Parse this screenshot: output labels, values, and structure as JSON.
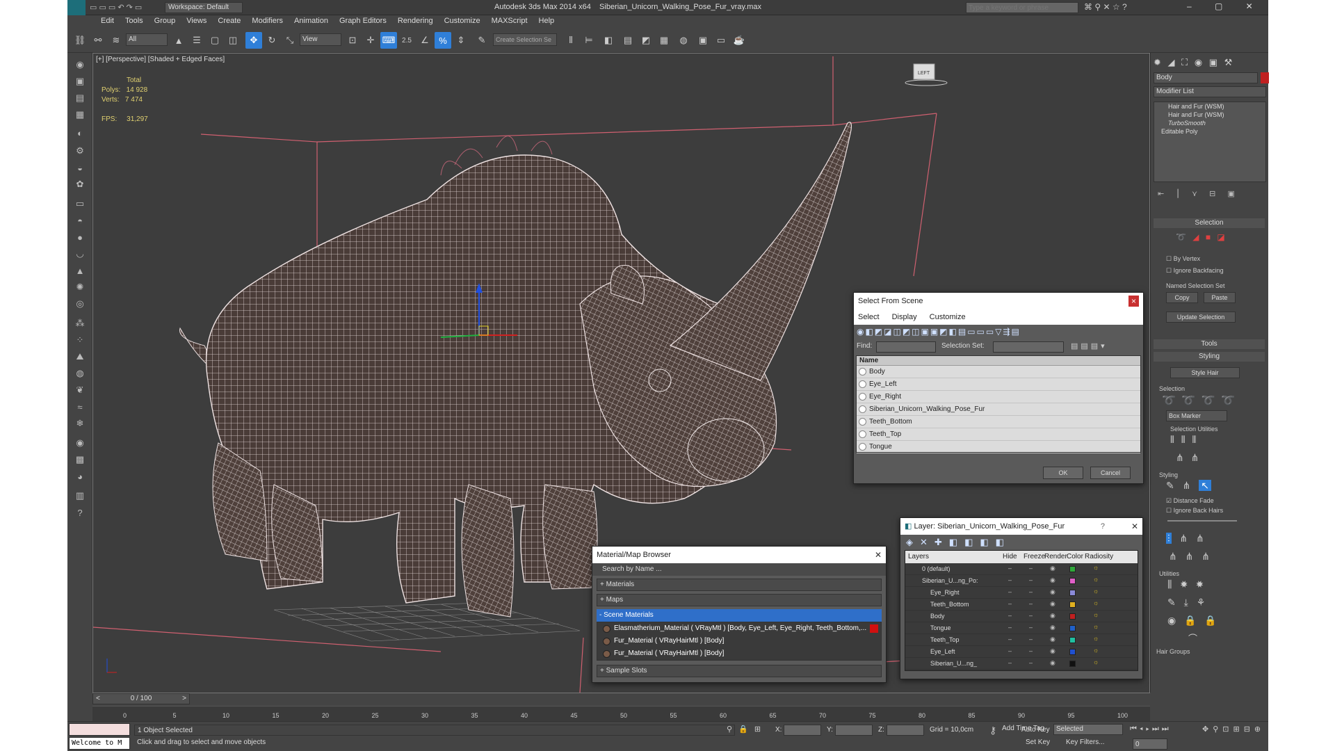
{
  "title": {
    "workspace": "Workspace: Default",
    "app": "Autodesk 3ds Max  2014 x64",
    "file": "Siberian_Unicorn_Walking_Pose_Fur_vray.max",
    "search_placeholder": "Type a keyword or phrase"
  },
  "menu": [
    "Edit",
    "Tools",
    "Group",
    "Views",
    "Create",
    "Modifiers",
    "Animation",
    "Graph Editors",
    "Rendering",
    "Customize",
    "MAXScript",
    "Help"
  ],
  "toolbar": {
    "filter": "All",
    "ref_coord": "View",
    "snap_val": "2.5",
    "selset": "Create Selection Se"
  },
  "viewport": {
    "label": "[+] [Perspective] [Shaded + Edged Faces]",
    "stats_total": "Total",
    "polys_label": "Polys:",
    "polys": "14 928",
    "verts_label": "Verts:",
    "verts": "7 474",
    "fps_label": "FPS:",
    "fps": "31,297"
  },
  "cmd": {
    "object_name": "Body",
    "modifier_list": "Modifier List",
    "stack": [
      "Hair and Fur (WSM)",
      "Hair and Fur (WSM)",
      "TurboSmooth",
      "Editable Poly"
    ],
    "selection_hdr": "Selection",
    "by_vertex": "By Vertex",
    "ignore_backfacing": "Ignore Backfacing",
    "named_sel": "Named Selection Set",
    "copy": "Copy",
    "paste": "Paste",
    "update_sel": "Update Selection",
    "tools_hdr": "Tools",
    "styling_hdr": "Styling",
    "style_hair": "Style Hair",
    "selection_sub": "Selection",
    "box_marker": "Box Marker",
    "sel_utils": "Selection Utilities",
    "styling_sub": "Styling",
    "distance_fade": "Distance Fade",
    "ignore_back_hairs": "Ignore Back Hairs",
    "utilities": "Utilities",
    "hair_groups": "Hair Groups"
  },
  "select_from_scene": {
    "title": "Select From Scene",
    "menus": [
      "Select",
      "Display",
      "Customize"
    ],
    "find": "Find:",
    "selection_set": "Selection Set:",
    "col_name": "Name",
    "items": [
      "Body",
      "Eye_Left",
      "Eye_Right",
      "Siberian_Unicorn_Walking_Pose_Fur",
      "Teeth_Bottom",
      "Teeth_Top",
      "Tongue"
    ],
    "ok": "OK",
    "cancel": "Cancel"
  },
  "material_browser": {
    "title": "Material/Map Browser",
    "search": "Search by Name ...",
    "materials": "+ Materials",
    "maps": "+ Maps",
    "scene_materials": "- Scene Materials",
    "entries": [
      "Elasmatherium_Material  ( VRayMtl ) [Body, Eye_Left, Eye_Right, Teeth_Bottom,...",
      "Fur_Material  ( VRayHairMtl ) [Body]",
      "Fur_Material  ( VRayHairMtl ) [Body]"
    ],
    "sample_slots": "+ Sample Slots"
  },
  "layer_dialog": {
    "title": "Layer: Siberian_Unicorn_Walking_Pose_Fur",
    "help": "?",
    "cols": [
      "Layers",
      "Hide",
      "Freeze",
      "Render",
      "Color",
      "Radiosity"
    ],
    "rows": [
      {
        "name": "0 (default)",
        "color": "#2fa83a"
      },
      {
        "name": "Siberian_U...ng_Po:",
        "color": "#e05fc8"
      },
      {
        "name": "Eye_Right",
        "color": "#8a8ad8"
      },
      {
        "name": "Teeth_Bottom",
        "color": "#e0b020"
      },
      {
        "name": "Body",
        "color": "#c02020"
      },
      {
        "name": "Tongue",
        "color": "#2060c8"
      },
      {
        "name": "Teeth_Top",
        "color": "#20c0a0"
      },
      {
        "name": "Eye_Left",
        "color": "#2050d0"
      },
      {
        "name": "Siberian_U...ng_",
        "color": "#111111"
      }
    ]
  },
  "timeline": {
    "frame": "0 / 100",
    "ticks": [
      "0",
      "5",
      "10",
      "15",
      "20",
      "25",
      "30",
      "35",
      "40",
      "45",
      "50",
      "55",
      "60",
      "65",
      "70",
      "75",
      "80",
      "85",
      "90",
      "95",
      "100"
    ]
  },
  "status": {
    "welcome": "Welcome to M",
    "selected": "1 Object Selected",
    "prompt": "Click and drag to select and move objects",
    "x": "X:",
    "y": "Y:",
    "z": "Z:",
    "grid": "Grid = 10,0cm",
    "auto_key": "Auto Key",
    "selected_dd": "Selected",
    "set_key": "Set Key",
    "key_filters": "Key Filters...",
    "add_time_tag": "Add Time Tag",
    "frame_field": "0"
  },
  "colors": {
    "accent": "#2f7fd8",
    "viewport_bg": "#3d3d3d",
    "wire": "#f0e6e6",
    "box": "#d06070",
    "scene_sel": "#2f6fc9"
  }
}
